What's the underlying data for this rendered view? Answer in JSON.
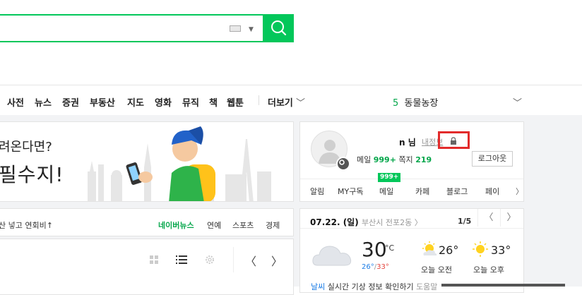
{
  "nav": {
    "items": [
      "사전",
      "뉴스",
      "증권",
      "부동산",
      "지도",
      "영화",
      "뮤직",
      "책",
      "웹툰"
    ],
    "more": "더보기",
    "more_caret": "〈",
    "ticker_num": "5",
    "ticker_text": "동물농장",
    "ticker_caret": "﹀"
  },
  "promo": {
    "line1": "려온다면?",
    "line2": "필수지!"
  },
  "headline": {
    "text": "산 넣고 연회비↑",
    "tabs": [
      "네이버뉴스",
      "연예",
      "스포츠",
      "경제"
    ]
  },
  "news_panel": {
    "prev": "〈",
    "next": "〉"
  },
  "account": {
    "user_name": "n 님",
    "my_info": "내정보",
    "mail_label": "메일",
    "mail_count": "999+",
    "note_label": "쪽지",
    "note_count": "219",
    "logout": "로그아웃",
    "mail_badge": "999+",
    "services": [
      "알림",
      "MY구독",
      "메일",
      "카페",
      "블로그",
      "페이"
    ],
    "services_arrow": "〉"
  },
  "weather": {
    "date": "07.22. (일)",
    "location": "부산시 전포2동 〉",
    "page": "1/5",
    "prev": "〈",
    "next": "〉",
    "temp": "30",
    "unit": "°C",
    "low": "26°",
    "high": "33°",
    "am_temp": "26°",
    "pm_temp": "33°",
    "am_label": "오늘 오전",
    "pm_label": "오늘 오후",
    "bottom_link": "날씨",
    "bottom_text": "실시간 기상 정보 확인하기",
    "bottom_extra": "도움말",
    "low_color": "#1e7ee6",
    "high_color": "#e4433c"
  },
  "colors": {
    "brand_green": "#03c75a",
    "highlight_red": "#e22b2b"
  }
}
